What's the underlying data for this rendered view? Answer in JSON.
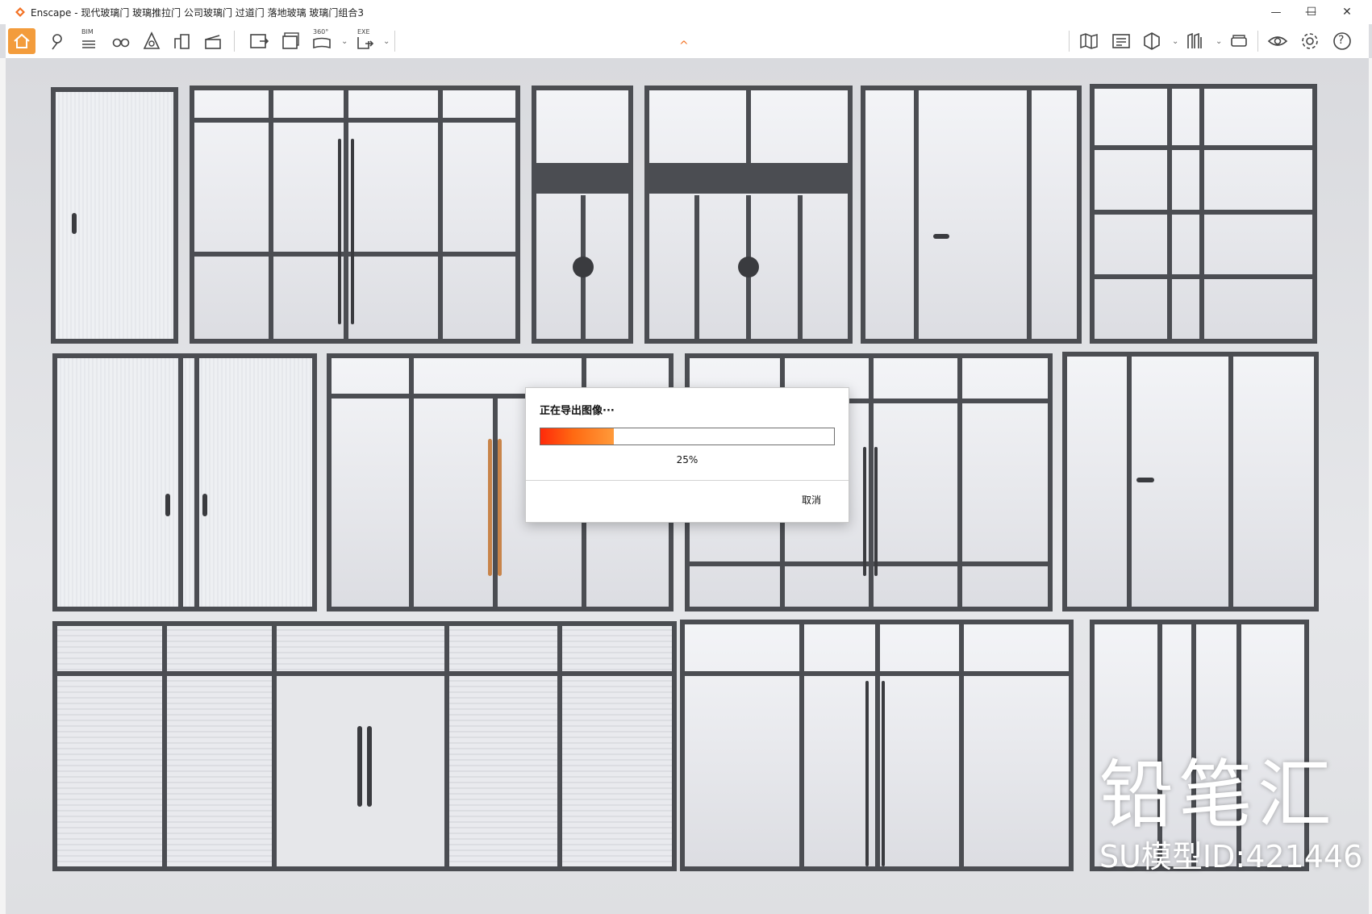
{
  "window": {
    "title": "Enscape - 现代玻璃门 玻璃推拉门 公司玻璃门 过道门 落地玻璃 玻璃门组合3",
    "minimize_glyph": "—",
    "maximize_glyph": "☐",
    "close_glyph": "✕"
  },
  "toolbar": {
    "bim_label": "BIM",
    "pano_label": "360°",
    "exe_label": "EXE",
    "help_glyph": "?",
    "collapse_glyph": "^"
  },
  "icons": [
    "home-icon",
    "location-pin-icon",
    "bim-icon",
    "binoculars-icon",
    "sun-icon",
    "buildings-icon",
    "clapper-icon",
    "screenshot-icon",
    "batch-render-icon",
    "panorama-icon",
    "export-exe-icon",
    "map-icon",
    "asset-library-icon",
    "cube-icon",
    "views-icon",
    "vr-headset-icon",
    "eye-icon",
    "gear-icon",
    "help-icon"
  ],
  "colors": {
    "accent": "#f39c3c",
    "progress_start": "#ff2a0a",
    "progress_end": "#ff9a3a",
    "frame": "#4b4d52"
  },
  "dialog": {
    "title": "正在导出图像···",
    "progress_fraction": 0.25,
    "percent_text": "25%",
    "cancel_label": "取消"
  },
  "watermark": {
    "brand": "铅笔汇",
    "model_id": "SU模型ID:421446"
  }
}
